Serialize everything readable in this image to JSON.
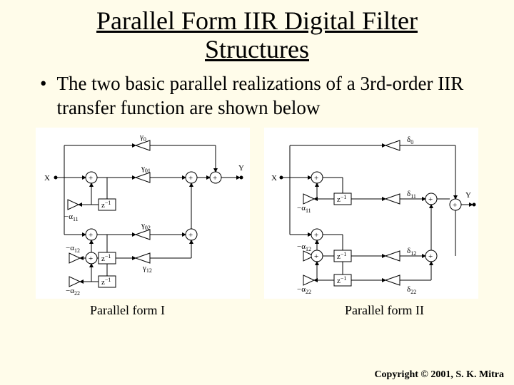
{
  "title_line1": "Parallel Form IIR Digital Filter",
  "title_line2": "Structures",
  "bullet_text": "The two basic parallel realizations of a 3rd-order IIR transfer function are shown below",
  "caption1": "Parallel form I",
  "caption2": "Parallel form II",
  "copyright": "Copyright © 2001, S. K. Mitra",
  "d1": {
    "x": "X",
    "y": "Y",
    "g0": "γ",
    "g0s": "0",
    "g01": "γ",
    "g01s": "01",
    "g02": "γ",
    "g02s": "02",
    "g12": "γ",
    "g12s": "12",
    "a11": "−α",
    "a11s": "11",
    "a12": "−α",
    "a12s": "12",
    "a22": "−α",
    "a22s": "22",
    "z": "z",
    "zs": "−1"
  },
  "d2": {
    "x": "X",
    "y": "Y",
    "d0": "δ",
    "d0s": "0",
    "d11": "δ",
    "d11s": "11",
    "d12": "δ",
    "d12s": "12",
    "d22": "δ",
    "d22s": "22",
    "a11": "−α",
    "a11s": "11",
    "a12": "−α",
    "a12s": "12",
    "a22": "−α",
    "a22s": "22",
    "z": "z",
    "zs": "−1"
  }
}
